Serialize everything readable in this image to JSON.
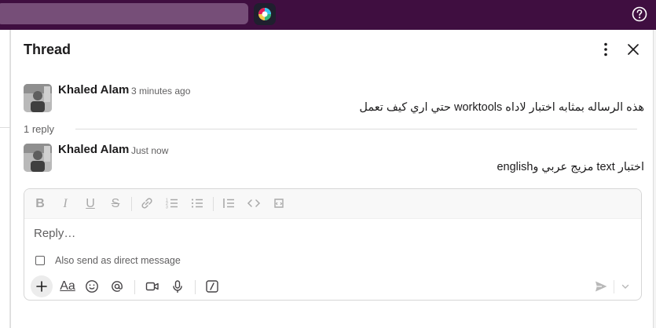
{
  "panel": {
    "title": "Thread"
  },
  "messages": [
    {
      "author": "Khaled Alam",
      "time": "3 minutes ago",
      "text": "هذه الرساله بمثابه اختبار لاداه worktools حتي اري كيف تعمل"
    },
    {
      "author": "Khaled Alam",
      "time": "Just now",
      "text": "اختبار text مزيج عربي وenglish"
    }
  ],
  "replies": {
    "count_label": "1 reply"
  },
  "composer": {
    "placeholder": "Reply…",
    "also_send_label": "Also send as direct message",
    "also_send_checked": false,
    "formatting_icons": [
      "bold-icon",
      "italic-icon",
      "underline-icon",
      "strikethrough-icon",
      "link-icon",
      "ordered-list-icon",
      "bulleted-list-icon",
      "blockquote-icon",
      "code-icon",
      "code-block-icon"
    ],
    "toolbar_icons": [
      "plus-icon",
      "text-format-icon",
      "emoji-icon",
      "mention-icon",
      "video-icon",
      "microphone-icon",
      "slash-command-icon",
      "send-icon",
      "chevron-down-icon"
    ],
    "format_label": "Aa"
  },
  "colors": {
    "topbar": "#3f0e40",
    "search": "#764e78"
  }
}
